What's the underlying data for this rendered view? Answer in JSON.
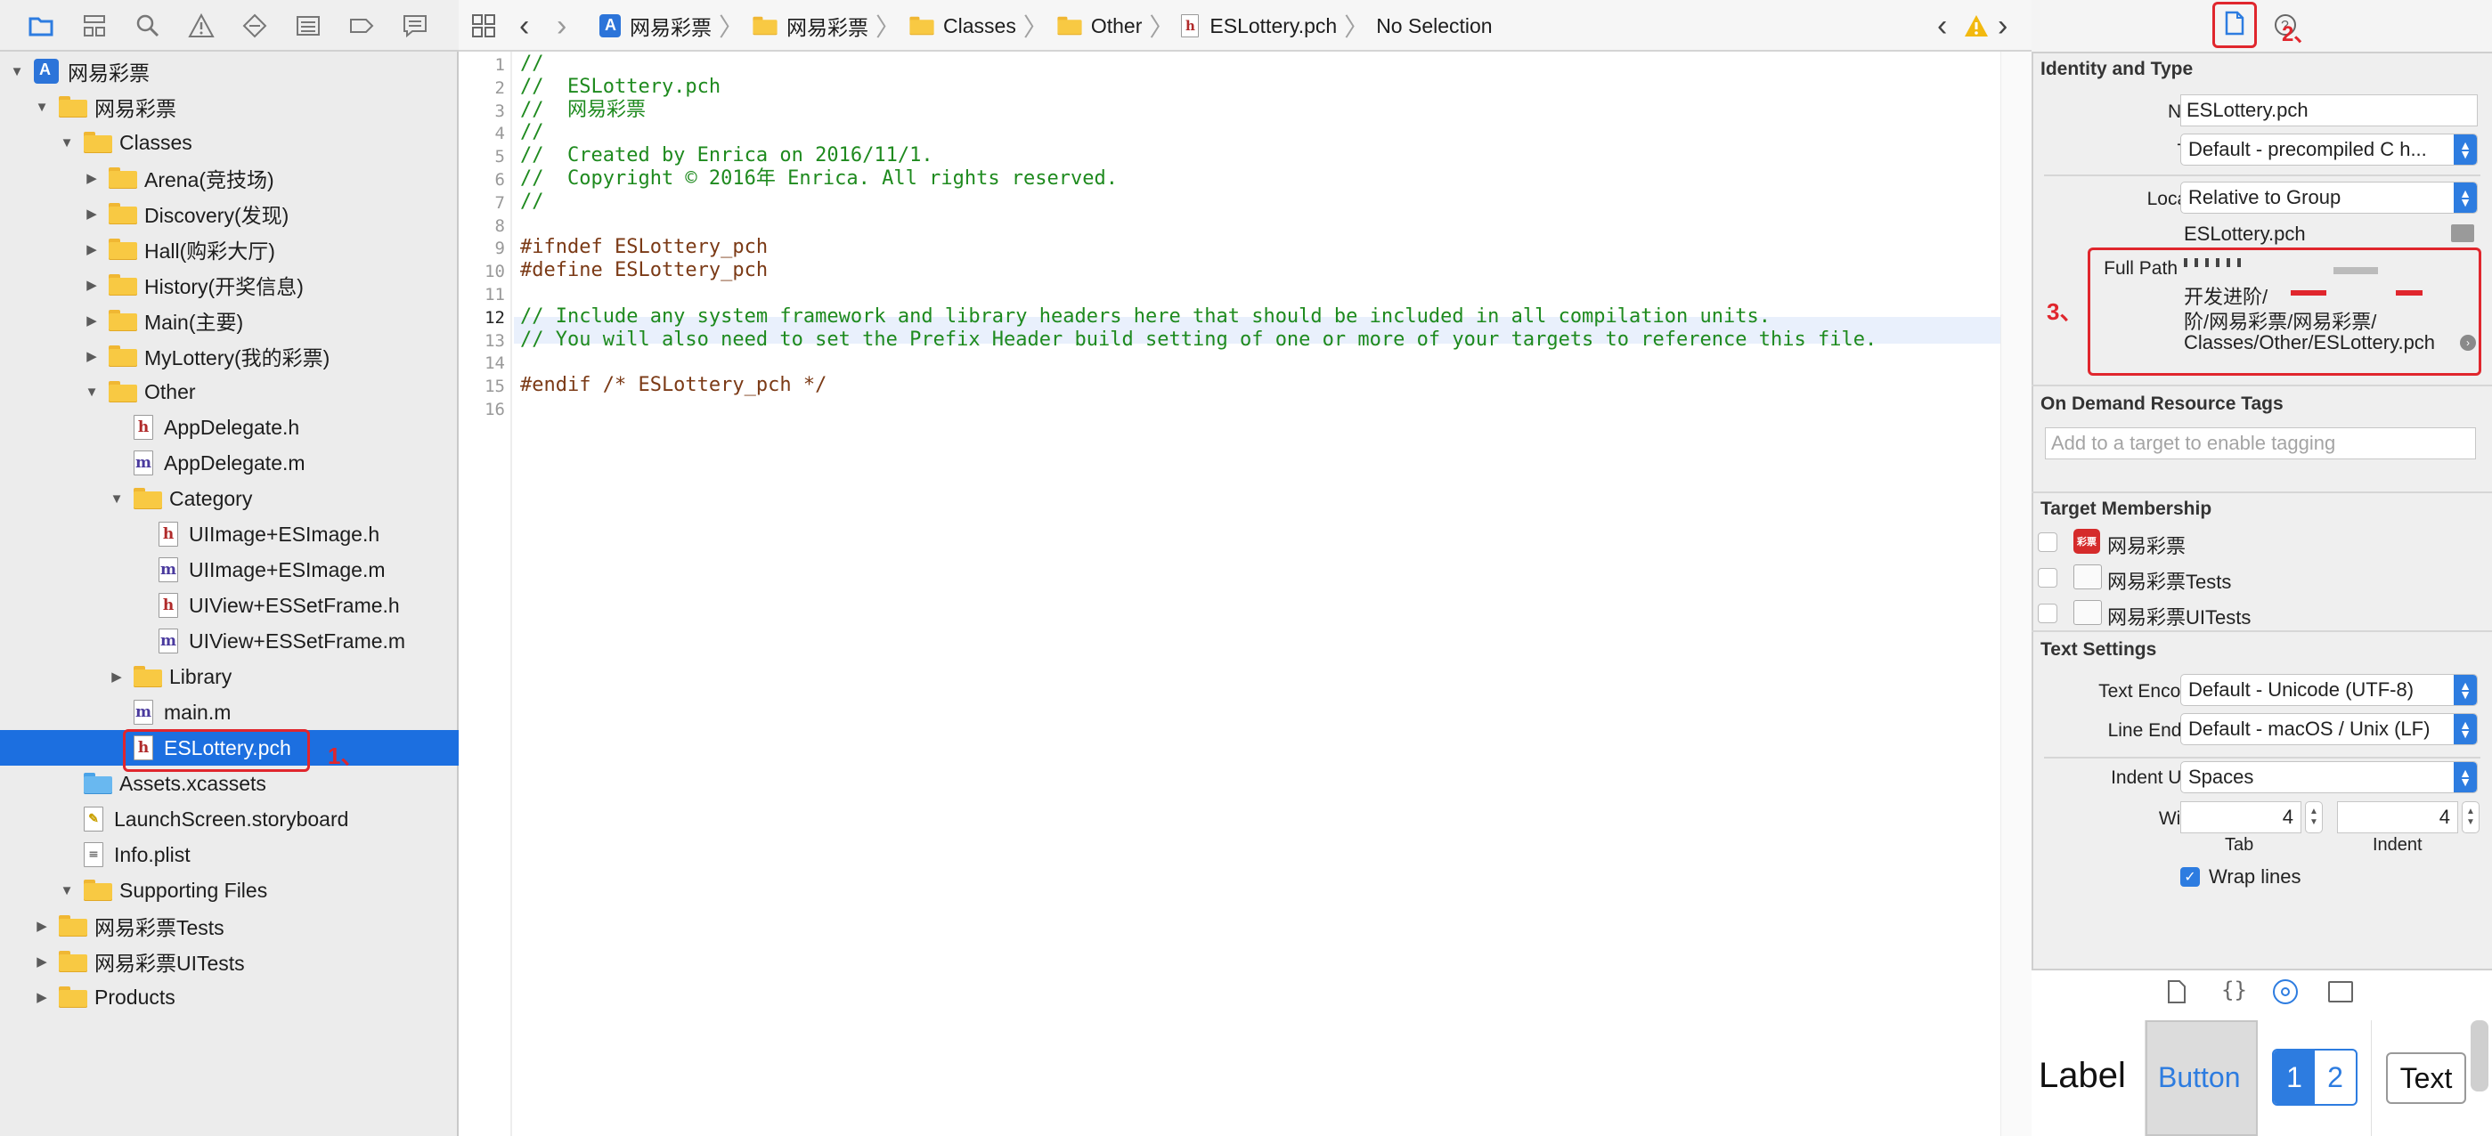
{
  "navigator": {
    "toolbar_icons": [
      "folder-icon",
      "hierarchy-icon",
      "search-icon",
      "warning-icon",
      "test-icon",
      "debug-icon",
      "breakpoint-icon",
      "report-icon"
    ],
    "items": [
      {
        "label": "网易彩票",
        "kind": "project",
        "depth": 0,
        "open": true
      },
      {
        "label": "网易彩票",
        "kind": "folder",
        "depth": 1,
        "open": true
      },
      {
        "label": "Classes",
        "kind": "folder",
        "depth": 2,
        "open": true
      },
      {
        "label": "Arena(竞技场)",
        "kind": "folder",
        "depth": 3,
        "open": false
      },
      {
        "label": "Discovery(发现)",
        "kind": "folder",
        "depth": 3,
        "open": false
      },
      {
        "label": "Hall(购彩大厅)",
        "kind": "folder",
        "depth": 3,
        "open": false
      },
      {
        "label": "History(开奖信息)",
        "kind": "folder",
        "depth": 3,
        "open": false
      },
      {
        "label": "Main(主要)",
        "kind": "folder",
        "depth": 3,
        "open": false
      },
      {
        "label": "MyLottery(我的彩票)",
        "kind": "folder",
        "depth": 3,
        "open": false
      },
      {
        "label": "Other",
        "kind": "folder",
        "depth": 3,
        "open": true
      },
      {
        "label": "AppDelegate.h",
        "kind": "h",
        "depth": 4
      },
      {
        "label": "AppDelegate.m",
        "kind": "m",
        "depth": 4
      },
      {
        "label": "Category",
        "kind": "folder",
        "depth": 4,
        "open": true
      },
      {
        "label": "UIImage+ESImage.h",
        "kind": "h",
        "depth": 5
      },
      {
        "label": "UIImage+ESImage.m",
        "kind": "m",
        "depth": 5
      },
      {
        "label": "UIView+ESSetFrame.h",
        "kind": "h",
        "depth": 5
      },
      {
        "label": "UIView+ESSetFrame.m",
        "kind": "m",
        "depth": 5
      },
      {
        "label": "Library",
        "kind": "folder",
        "depth": 4,
        "open": false
      },
      {
        "label": "main.m",
        "kind": "m",
        "depth": 4
      },
      {
        "label": "ESLottery.pch",
        "kind": "h",
        "depth": 4,
        "selected": true
      },
      {
        "label": "Assets.xcassets",
        "kind": "assets",
        "depth": 2
      },
      {
        "label": "LaunchScreen.storyboard",
        "kind": "storyboard",
        "depth": 2
      },
      {
        "label": "Info.plist",
        "kind": "plist",
        "depth": 2
      },
      {
        "label": "Supporting Files",
        "kind": "folder",
        "depth": 2,
        "open": true
      },
      {
        "label": "网易彩票Tests",
        "kind": "folder",
        "depth": 1,
        "open": false
      },
      {
        "label": "网易彩票UITests",
        "kind": "folder",
        "depth": 1,
        "open": false
      },
      {
        "label": "Products",
        "kind": "folder",
        "depth": 1,
        "open": false
      }
    ],
    "annotation": "1、"
  },
  "jumpbar": {
    "crumbs": [
      "网易彩票",
      "网易彩票",
      "Classes",
      "Other",
      "ESLottery.pch",
      "No Selection"
    ]
  },
  "editor": {
    "current_line": 12,
    "lines": [
      {
        "n": "1",
        "text": "//",
        "cls": "cm"
      },
      {
        "n": "2",
        "text": "//  ESLottery.pch",
        "cls": "cm"
      },
      {
        "n": "3",
        "text": "//  网易彩票",
        "cls": "cm"
      },
      {
        "n": "4",
        "text": "//",
        "cls": "cm"
      },
      {
        "n": "5",
        "text": "//  Created by Enrica on 2016/11/1.",
        "cls": "cm"
      },
      {
        "n": "6",
        "text": "//  Copyright © 2016年 Enrica. All rights reserved.",
        "cls": "cm"
      },
      {
        "n": "7",
        "text": "//",
        "cls": "cm"
      },
      {
        "n": "8",
        "text": "",
        "cls": ""
      },
      {
        "n": "9",
        "text": "#ifndef ESLottery_pch",
        "cls": "pp"
      },
      {
        "n": "10",
        "text": "#define ESLottery_pch",
        "cls": "pp"
      },
      {
        "n": "11",
        "text": "",
        "cls": ""
      },
      {
        "n": "12",
        "text": "// Include any system framework and library headers here that should be included in all compilation units.",
        "cls": "cm"
      },
      {
        "n": "13",
        "text": "// You will also need to set the Prefix Header build setting of one or more of your targets to reference this file.",
        "cls": "cm"
      },
      {
        "n": "14",
        "text": "",
        "cls": ""
      },
      {
        "n": "15",
        "text": "#endif /* ESLottery_pch */",
        "cls": "pp"
      },
      {
        "n": "16",
        "text": "",
        "cls": ""
      }
    ]
  },
  "inspector": {
    "annotation_tab": "2、",
    "annotation_path": "3、",
    "identity": {
      "header": "Identity and Type",
      "name_label": "Name",
      "name_value": "ESLottery.pch",
      "type_label": "Type",
      "type_value": "Default - precompiled C h...",
      "location_label": "Location",
      "location_value": "Relative to Group",
      "location_file": "ESLottery.pch",
      "fullpath_label": "Full Path",
      "fullpath_lines": [
        "开发进阶/",
        "阶/网易彩票/网易彩票/",
        "Classes/Other/ESLottery.pch"
      ]
    },
    "on_demand": {
      "header": "On Demand Resource Tags",
      "placeholder": "Add to a target to enable tagging"
    },
    "membership": {
      "header": "Target Membership",
      "targets": [
        "网易彩票",
        "网易彩票Tests",
        "网易彩票UITests"
      ],
      "app_badge": "彩票"
    },
    "text_settings": {
      "header": "Text Settings",
      "encoding_label": "Text Encoding",
      "encoding_value": "Default - Unicode (UTF-8)",
      "endings_label": "Line Endings",
      "endings_value": "Default - macOS / Unix (LF)",
      "indent_label": "Indent Using",
      "indent_value": "Spaces",
      "widths_label": "Widths",
      "tab_value": "4",
      "indent_width_value": "4",
      "tab_label": "Tab",
      "indent_sub_label": "Indent",
      "wrap_label": "Wrap lines"
    },
    "library": {
      "items": [
        "Label",
        "Button",
        "1",
        "2",
        "Text"
      ]
    }
  }
}
